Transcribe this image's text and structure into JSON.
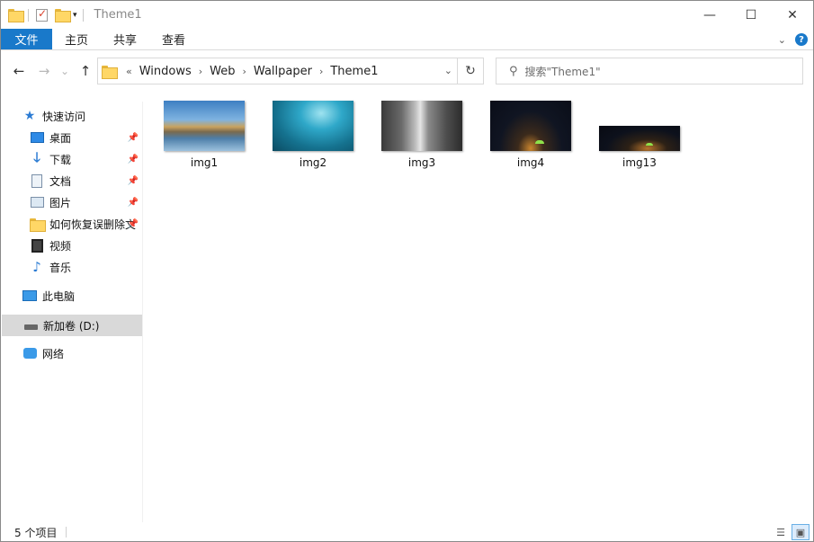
{
  "titlebar": {
    "title": "Theme1",
    "minimize": "—",
    "maximize": "☐",
    "close": "✕"
  },
  "ribbon": {
    "tabs": [
      "文件",
      "主页",
      "共享",
      "查看"
    ]
  },
  "nav": {
    "back": "←",
    "forward": "→",
    "recent": "⌄",
    "up": "↑",
    "breadcrumb_prefix": "«",
    "breadcrumbs": [
      "Windows",
      "Web",
      "Wallpaper",
      "Theme1"
    ],
    "refresh": "↻",
    "search_placeholder": "搜索\"Theme1\""
  },
  "sidebar": {
    "quick_access": "快速访问",
    "items": [
      {
        "label": "桌面",
        "icon": "desktop-icon",
        "pinned": true
      },
      {
        "label": "下载",
        "icon": "download-icon",
        "pinned": true
      },
      {
        "label": "文档",
        "icon": "document-icon",
        "pinned": true
      },
      {
        "label": "图片",
        "icon": "picture-icon",
        "pinned": true
      },
      {
        "label": "如何恢复误删除文",
        "icon": "folder-icon",
        "pinned": true
      },
      {
        "label": "视频",
        "icon": "video-icon",
        "pinned": false
      },
      {
        "label": "音乐",
        "icon": "music-icon",
        "pinned": false
      }
    ],
    "this_pc": "此电脑",
    "drive": "新加卷 (D:)",
    "network": "网络"
  },
  "files": [
    {
      "name": "img1"
    },
    {
      "name": "img2"
    },
    {
      "name": "img3"
    },
    {
      "name": "img4"
    },
    {
      "name": "img13"
    }
  ],
  "status": {
    "count": "5 个项目"
  },
  "colors": {
    "accent": "#1979ca",
    "selected": "#d9d9d9"
  }
}
